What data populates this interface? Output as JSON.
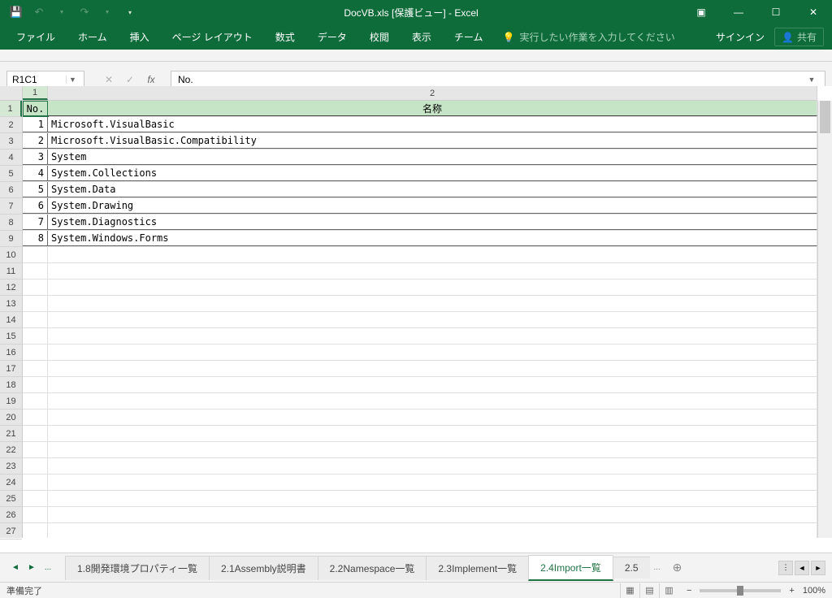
{
  "title": "DocVB.xls [保護ビュー] - Excel",
  "qat": {
    "undo_dim": true,
    "redo_dim": true
  },
  "win": {
    "restore_down_icon": "🗗"
  },
  "ribbon": {
    "tabs": [
      "ファイル",
      "ホーム",
      "挿入",
      "ページ レイアウト",
      "数式",
      "データ",
      "校閲",
      "表示",
      "チーム"
    ],
    "tell_me": "実行したい作業を入力してください",
    "signin": "サインイン",
    "share": "共有"
  },
  "formula": {
    "name_box": "R1C1",
    "fx_value": "No."
  },
  "columns": [
    "1",
    "2"
  ],
  "header_row": {
    "no": "No.",
    "name": "名称"
  },
  "data_rows": [
    {
      "no": "1",
      "name": "Microsoft.VisualBasic"
    },
    {
      "no": "2",
      "name": "Microsoft.VisualBasic.Compatibility"
    },
    {
      "no": "3",
      "name": "System"
    },
    {
      "no": "4",
      "name": "System.Collections"
    },
    {
      "no": "5",
      "name": "System.Data"
    },
    {
      "no": "6",
      "name": "System.Drawing"
    },
    {
      "no": "7",
      "name": "System.Diagnostics"
    },
    {
      "no": "8",
      "name": "System.Windows.Forms"
    }
  ],
  "row_numbers": [
    "1",
    "2",
    "3",
    "4",
    "5",
    "6",
    "7",
    "8",
    "9",
    "10",
    "11",
    "12",
    "13",
    "14",
    "15",
    "16",
    "17",
    "18",
    "19",
    "20",
    "21",
    "22",
    "23",
    "24",
    "25",
    "26",
    "27"
  ],
  "sheet_nav": {
    "ellipsis": "..."
  },
  "sheets": [
    {
      "label": "1.8開発環境プロパティ一覧",
      "active": false
    },
    {
      "label": "2.1Assembly説明書",
      "active": false
    },
    {
      "label": "2.2Namespace一覧",
      "active": false
    },
    {
      "label": "2.3Implement一覧",
      "active": false
    },
    {
      "label": "2.4Import一覧",
      "active": true
    },
    {
      "label": "2.5",
      "active": false
    }
  ],
  "sheet_trailing": "...",
  "status": {
    "ready": "準備完了",
    "zoom": "100%"
  }
}
